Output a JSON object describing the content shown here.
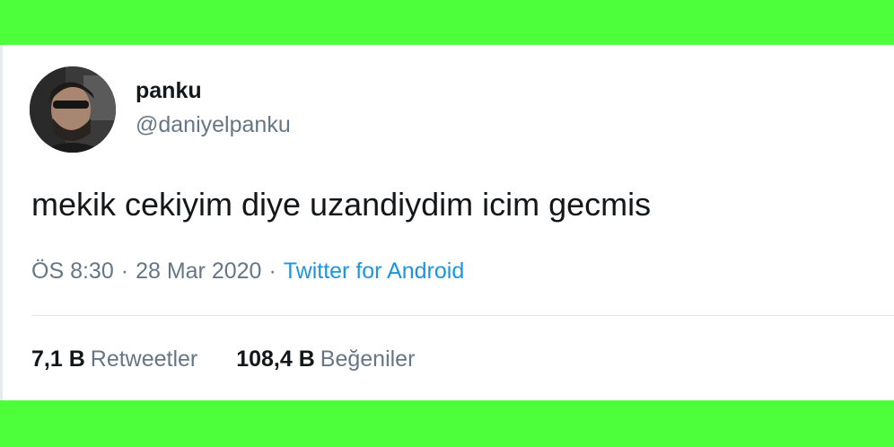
{
  "tweet": {
    "author": {
      "display_name": "panku",
      "handle": "@daniyelpanku"
    },
    "text": "mekik cekiyim diye uzandiydim icim gecmis",
    "time": "ÖS 8:30",
    "date": "28 Mar 2020",
    "separator": "·",
    "source": "Twitter for Android",
    "stats": {
      "retweets_count": "7,1 B",
      "retweets_label": "Retweetler",
      "likes_count": "108,4 B",
      "likes_label": "Beğeniler"
    }
  },
  "colors": {
    "background": "#4dff3a",
    "card": "#ffffff",
    "text_primary": "#14171a",
    "text_secondary": "#657786",
    "link": "#1b95e0"
  }
}
